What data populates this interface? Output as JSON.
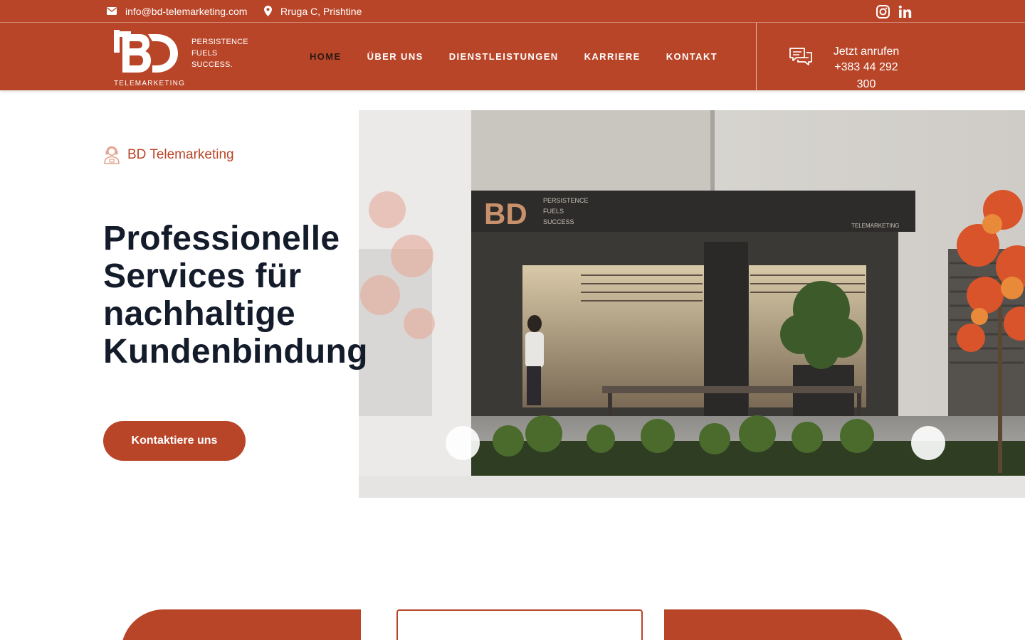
{
  "topbar": {
    "email": "info@bd-telemarketing.com",
    "address": "Rruga C, Prishtine",
    "social_icons": [
      "instagram-icon",
      "linkedin-icon"
    ]
  },
  "logo": {
    "mark": "BD",
    "tagline": [
      "PERSISTENCE",
      "FUELS",
      "SUCCESS."
    ],
    "subtitle": "TELEMARKETING"
  },
  "nav": {
    "items": [
      {
        "label": "HOME",
        "active": true
      },
      {
        "label": "ÜBER UNS",
        "active": false
      },
      {
        "label": "DIENSTLEISTUNGEN",
        "active": false
      },
      {
        "label": "KARRIERE",
        "active": false
      },
      {
        "label": "KONTAKT",
        "active": false
      }
    ]
  },
  "call": {
    "label": "Jetzt anrufen",
    "phone": "+383 44 292 300"
  },
  "hero": {
    "eyebrow": "BD Telemarketing",
    "headline_lines": [
      "Professionelle",
      "Services für",
      "nachhaltige",
      "Kundenbindung"
    ],
    "cta_label": "Kontaktiere uns",
    "image_sign": {
      "mark": "BD",
      "tagline": [
        "PERSISTENCE",
        "FUELS",
        "SUCCESS"
      ],
      "subtitle": "TELEMARKETING"
    }
  },
  "colors": {
    "brand": "#b94528",
    "heading": "#141c2b",
    "nav_active": "#2a1a14"
  }
}
